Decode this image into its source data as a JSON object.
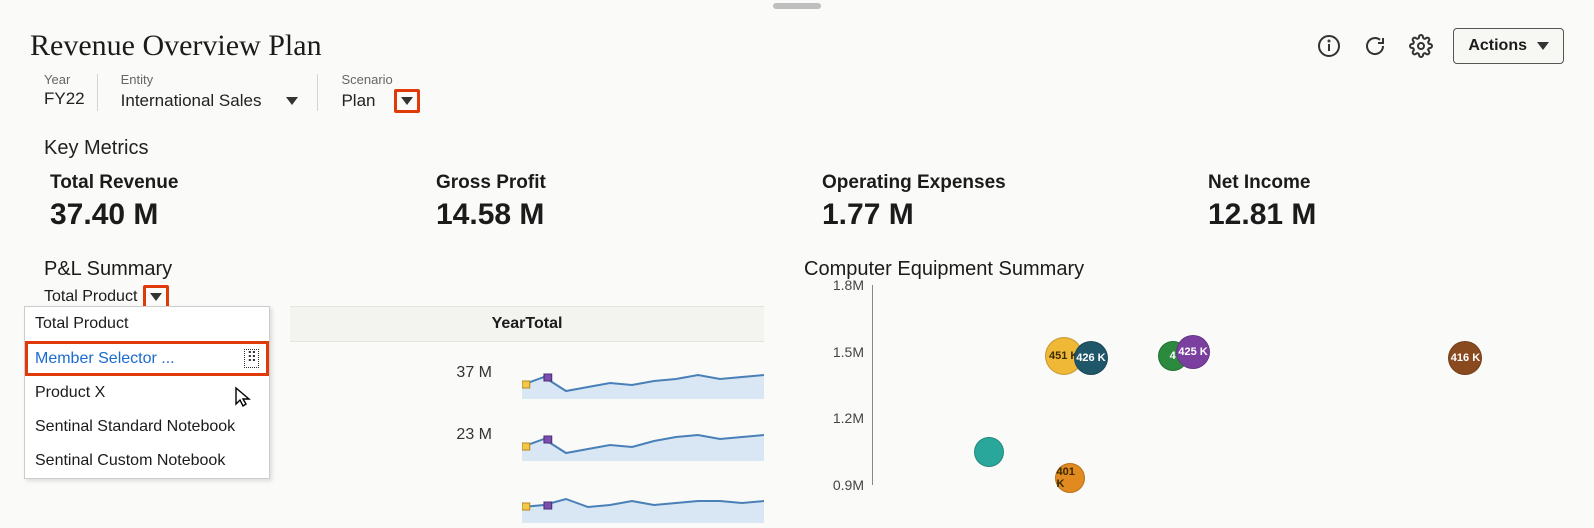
{
  "page_title": "Revenue Overview Plan",
  "header": {
    "actions_label": "Actions"
  },
  "filters": {
    "year": {
      "label": "Year",
      "value": "FY22"
    },
    "entity": {
      "label": "Entity",
      "value": "International Sales"
    },
    "scenario": {
      "label": "Scenario",
      "value": "Plan"
    }
  },
  "key_metrics_title": "Key Metrics",
  "metrics": [
    {
      "label": "Total Revenue",
      "value": "37.40 M"
    },
    {
      "label": "Gross Profit",
      "value": "14.58 M"
    },
    {
      "label": "Operating Expenses",
      "value": "1.77 M"
    },
    {
      "label": "Net Income",
      "value": "12.81 M"
    }
  ],
  "pnl": {
    "title": "P&L Summary",
    "selected_product": "Total Product",
    "column_header": "YearTotal",
    "rows": [
      {
        "value": "37 M"
      },
      {
        "value": "23 M"
      },
      {
        "value": ""
      }
    ],
    "dropdown_items": [
      "Total Product",
      "Member Selector ...",
      "Product X",
      "Sentinal Standard Notebook",
      "Sentinal Custom Notebook"
    ]
  },
  "equipment": {
    "title": "Computer Equipment Summary"
  },
  "chart_data": {
    "bubble": {
      "type": "bubble",
      "ylabel": "",
      "y_ticks": [
        "1.8M",
        "1.5M",
        "1.2M",
        "0.9M"
      ],
      "ylim_m": [
        0.9,
        1.8
      ],
      "bubbles": [
        {
          "label": "",
          "y_m": 1.05,
          "x_pct": 17,
          "size": 30,
          "color": "#2aa79b"
        },
        {
          "label": "451 K",
          "y_m": 1.48,
          "x_pct": 28,
          "size": 38,
          "color": "#efb836",
          "dark_text": true
        },
        {
          "label": "426 K",
          "y_m": 1.47,
          "x_pct": 32,
          "size": 34,
          "color": "#1f566a"
        },
        {
          "label": "401 K",
          "y_m": 0.93,
          "x_pct": 29,
          "size": 30,
          "color": "#e08a1f",
          "dark_text": true
        },
        {
          "label": "4",
          "y_m": 1.48,
          "x_pct": 44,
          "size": 30,
          "color": "#2b8a3e"
        },
        {
          "label": "425 K",
          "y_m": 1.5,
          "x_pct": 47,
          "size": 34,
          "color": "#7b3fa0"
        },
        {
          "label": "416 K",
          "y_m": 1.47,
          "x_pct": 87,
          "size": 34,
          "color": "#8a4a1f"
        }
      ]
    },
    "sparklines": {
      "type": "line",
      "series": [
        {
          "value_label": "37 M",
          "points": [
            38,
            30,
            44,
            40,
            36,
            38,
            34,
            32,
            28,
            32,
            30,
            28
          ]
        },
        {
          "value_label": "23 M",
          "points": [
            38,
            30,
            44,
            40,
            36,
            38,
            32,
            28,
            26,
            30,
            28,
            26
          ]
        },
        {
          "value_label": "",
          "points": [
            36,
            34,
            28,
            36,
            34,
            30,
            34,
            32,
            30,
            30,
            32,
            30
          ]
        }
      ]
    }
  }
}
